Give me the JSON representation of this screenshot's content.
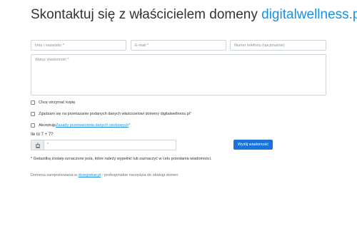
{
  "header": {
    "title_prefix": "Skontaktuj się z właścicielem domeny ",
    "domain": "digitalwellness.pl"
  },
  "form": {
    "name_placeholder": "Imię i nazwisko *",
    "email_placeholder": "E-mail *",
    "phone_placeholder": "Numer telefonu (opcjonalnie)",
    "message_placeholder": "Wpisz wiadomość *",
    "copy_label": "Chcę otrzymać kopię",
    "consent_label": "Zgadzam się na przekazanie podanych danych właścicielowi domeny digitalwellness.pl",
    "consent_star": "*",
    "privacy_prefix": "Akceptuję ",
    "privacy_link": "Zasady przetwarzania danych osobowych",
    "privacy_star": "*",
    "captcha_label": "Ile to 7 + 7?",
    "captcha_placeholder": "*",
    "submit_label": "Wyślij wiadomość"
  },
  "note": "* Gwiazdką zostały oznaczone pola, które należy wypełnić lub zaznaczyć w celu przesłania wiadomości.",
  "footer": {
    "prefix": "Domena zarejestrowana w ",
    "link": "dcregistrar.pl",
    "suffix": " - profesjonalne narzędzia do obsługi domen"
  },
  "icons": {
    "captcha": "robot-icon"
  }
}
